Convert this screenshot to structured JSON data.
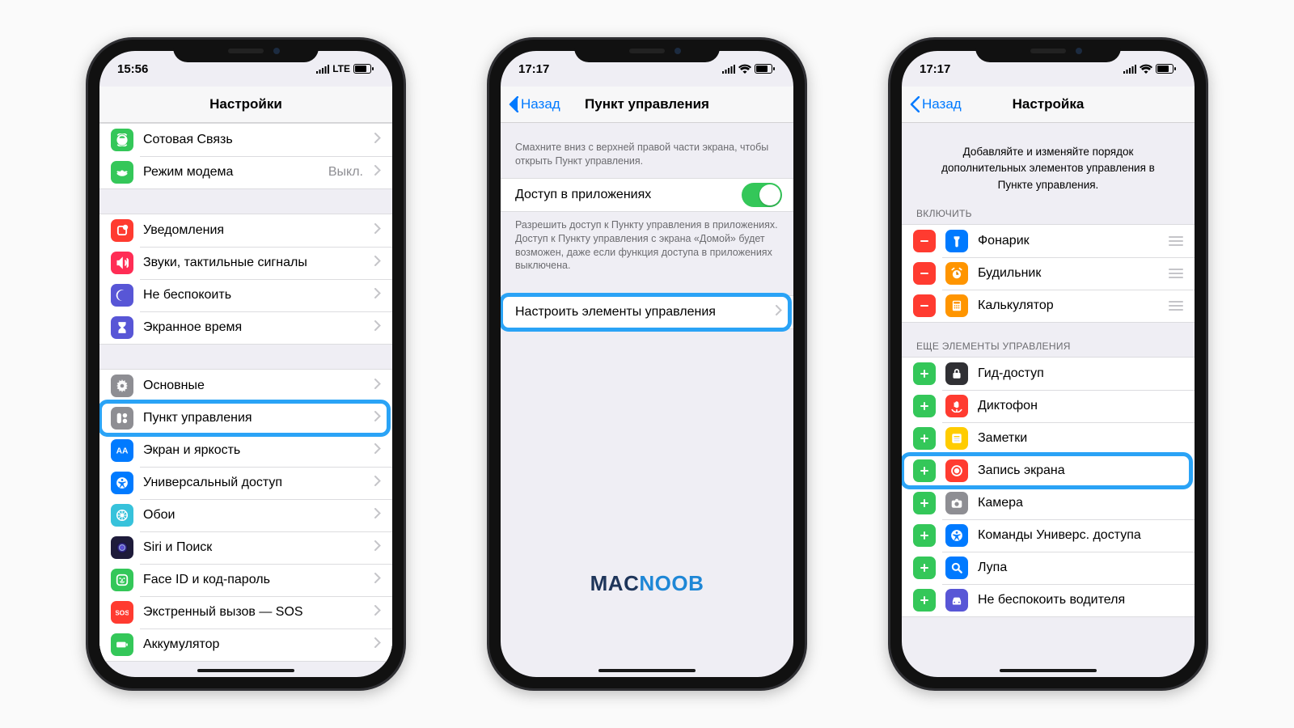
{
  "watermark": {
    "part1": "MAC",
    "part2": "NOOB"
  },
  "chevron_icon": "›",
  "phone1": {
    "status": {
      "time": "15:56",
      "net": "LTE"
    },
    "nav": {
      "title": "Настройки",
      "back": null
    },
    "groups": [
      {
        "items": [
          {
            "icon": "cellular",
            "bg": "#34c759",
            "label": "Сотовая Связь",
            "value": null
          },
          {
            "icon": "hotspot",
            "bg": "#34c759",
            "label": "Режим модема",
            "value": "Выкл."
          }
        ]
      },
      {
        "items": [
          {
            "icon": "notifications",
            "bg": "#ff3b30",
            "label": "Уведомления"
          },
          {
            "icon": "sounds",
            "bg": "#ff2d55",
            "label": "Звуки, тактильные сигналы"
          },
          {
            "icon": "moon",
            "bg": "#5856d6",
            "label": "Не беспокоить"
          },
          {
            "icon": "hourglass",
            "bg": "#5856d6",
            "label": "Экранное время"
          }
        ]
      },
      {
        "items": [
          {
            "icon": "gear",
            "bg": "#8e8e93",
            "label": "Основные"
          },
          {
            "icon": "control",
            "bg": "#8e8e93",
            "label": "Пункт управления",
            "highlight": true
          },
          {
            "icon": "aa",
            "bg": "#007aff",
            "label": "Экран и яркость"
          },
          {
            "icon": "accessibility",
            "bg": "#007aff",
            "label": "Универсальный доступ"
          },
          {
            "icon": "wallpaper",
            "bg": "#37c2db",
            "label": "Обои"
          },
          {
            "icon": "siri",
            "bg": "#1e1b3a",
            "label": "Siri и Поиск"
          },
          {
            "icon": "faceid",
            "bg": "#34c759",
            "label": "Face ID и код-пароль"
          },
          {
            "icon": "sos",
            "bg": "#ff3b30",
            "label": "Экстренный вызов — SOS"
          },
          {
            "icon": "battery",
            "bg": "#34c759",
            "label": "Аккумулятор"
          }
        ]
      }
    ]
  },
  "phone2": {
    "status": {
      "time": "17:17",
      "net": ""
    },
    "nav": {
      "title": "Пункт управления",
      "back": "Назад"
    },
    "desc1": "Смахните вниз с верхней правой части экрана, чтобы открыть Пункт управления.",
    "toggle_label": "Доступ в приложениях",
    "footer": "Разрешить доступ к Пункту управления в приложениях. Доступ к Пункту управления с экрана «Домой» будет возможен, даже если функция доступа в приложениях выключена.",
    "customize_label": "Настроить элементы управления"
  },
  "phone3": {
    "status": {
      "time": "17:17",
      "net": ""
    },
    "nav": {
      "title": "Настройка",
      "back": "Назад"
    },
    "intro": "Добавляйте и изменяйте порядок дополнительных элементов управления в Пункте управления.",
    "sec_included": "ВКЛЮЧИТЬ",
    "sec_more": "ЕЩЕ ЭЛЕМЕНТЫ УПРАВЛЕНИЯ",
    "included": [
      {
        "icon": "flashlight",
        "bg": "#007aff",
        "label": "Фонарик"
      },
      {
        "icon": "alarm",
        "bg": "#ff9500",
        "label": "Будильник"
      },
      {
        "icon": "calc",
        "bg": "#ff9500",
        "label": "Калькулятор"
      }
    ],
    "more": [
      {
        "icon": "lock",
        "bg": "#303034",
        "label": "Гид-доступ"
      },
      {
        "icon": "voice",
        "bg": "#ff3b30",
        "label": "Диктофон"
      },
      {
        "icon": "notes",
        "bg": "#ffcc00",
        "label": "Заметки"
      },
      {
        "icon": "record",
        "bg": "#ff3b30",
        "label": "Запись экрана",
        "highlight": true
      },
      {
        "icon": "camera",
        "bg": "#8e8e93",
        "label": "Камера"
      },
      {
        "icon": "access",
        "bg": "#007aff",
        "label": "Команды Универс. доступа"
      },
      {
        "icon": "magnifier",
        "bg": "#007aff",
        "label": "Лупа"
      },
      {
        "icon": "car",
        "bg": "#5856d6",
        "label": "Не беспокоить водителя"
      }
    ]
  }
}
